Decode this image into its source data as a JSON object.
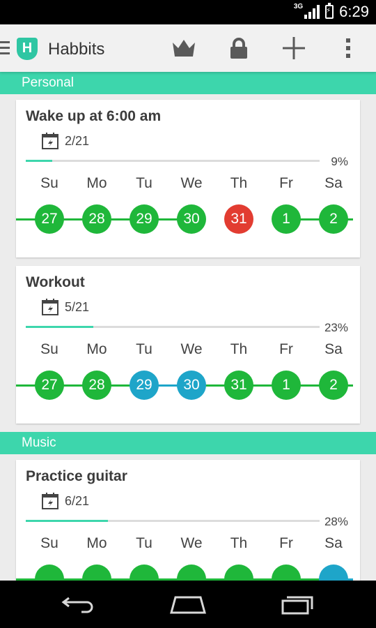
{
  "status": {
    "network": "3G",
    "time": "6:29"
  },
  "app": {
    "title": "Habbits",
    "logo_letter": "H"
  },
  "actions": [
    "crown-icon",
    "lock-icon",
    "plus-icon",
    "overflow-icon"
  ],
  "colors": {
    "accent": "#3dd6ac",
    "done": "#1fb73a",
    "missed": "#e23c31",
    "skipped": "#1ea5c9",
    "progress_track": "#dcdcdc"
  },
  "day_labels": [
    "Su",
    "Mo",
    "Tu",
    "We",
    "Th",
    "Fr",
    "Sa"
  ],
  "sections": [
    {
      "name": "Personal",
      "habits": [
        {
          "title": "Wake up at 6:00 am",
          "streak": "2/21",
          "percent": "9%",
          "progress": 0.09,
          "days": [
            {
              "date": "27",
              "state": "done"
            },
            {
              "date": "28",
              "state": "done"
            },
            {
              "date": "29",
              "state": "done"
            },
            {
              "date": "30",
              "state": "done"
            },
            {
              "date": "31",
              "state": "missed"
            },
            {
              "date": "1",
              "state": "done"
            },
            {
              "date": "2",
              "state": "done"
            }
          ]
        },
        {
          "title": "Workout",
          "streak": "5/21",
          "percent": "23%",
          "progress": 0.23,
          "days": [
            {
              "date": "27",
              "state": "done"
            },
            {
              "date": "28",
              "state": "done"
            },
            {
              "date": "29",
              "state": "skipped"
            },
            {
              "date": "30",
              "state": "skipped"
            },
            {
              "date": "31",
              "state": "done"
            },
            {
              "date": "1",
              "state": "done"
            },
            {
              "date": "2",
              "state": "done"
            }
          ]
        }
      ]
    },
    {
      "name": "Music",
      "habits": [
        {
          "title": "Practice guitar",
          "streak": "6/21",
          "percent": "28%",
          "progress": 0.28,
          "days": [
            {
              "date": "",
              "state": "done"
            },
            {
              "date": "",
              "state": "done"
            },
            {
              "date": "",
              "state": "done"
            },
            {
              "date": "",
              "state": "done"
            },
            {
              "date": "",
              "state": "done"
            },
            {
              "date": "",
              "state": "done"
            },
            {
              "date": "",
              "state": "skipped"
            }
          ]
        }
      ]
    }
  ],
  "navbar": [
    "back-icon",
    "home-icon",
    "recent-apps-icon"
  ]
}
